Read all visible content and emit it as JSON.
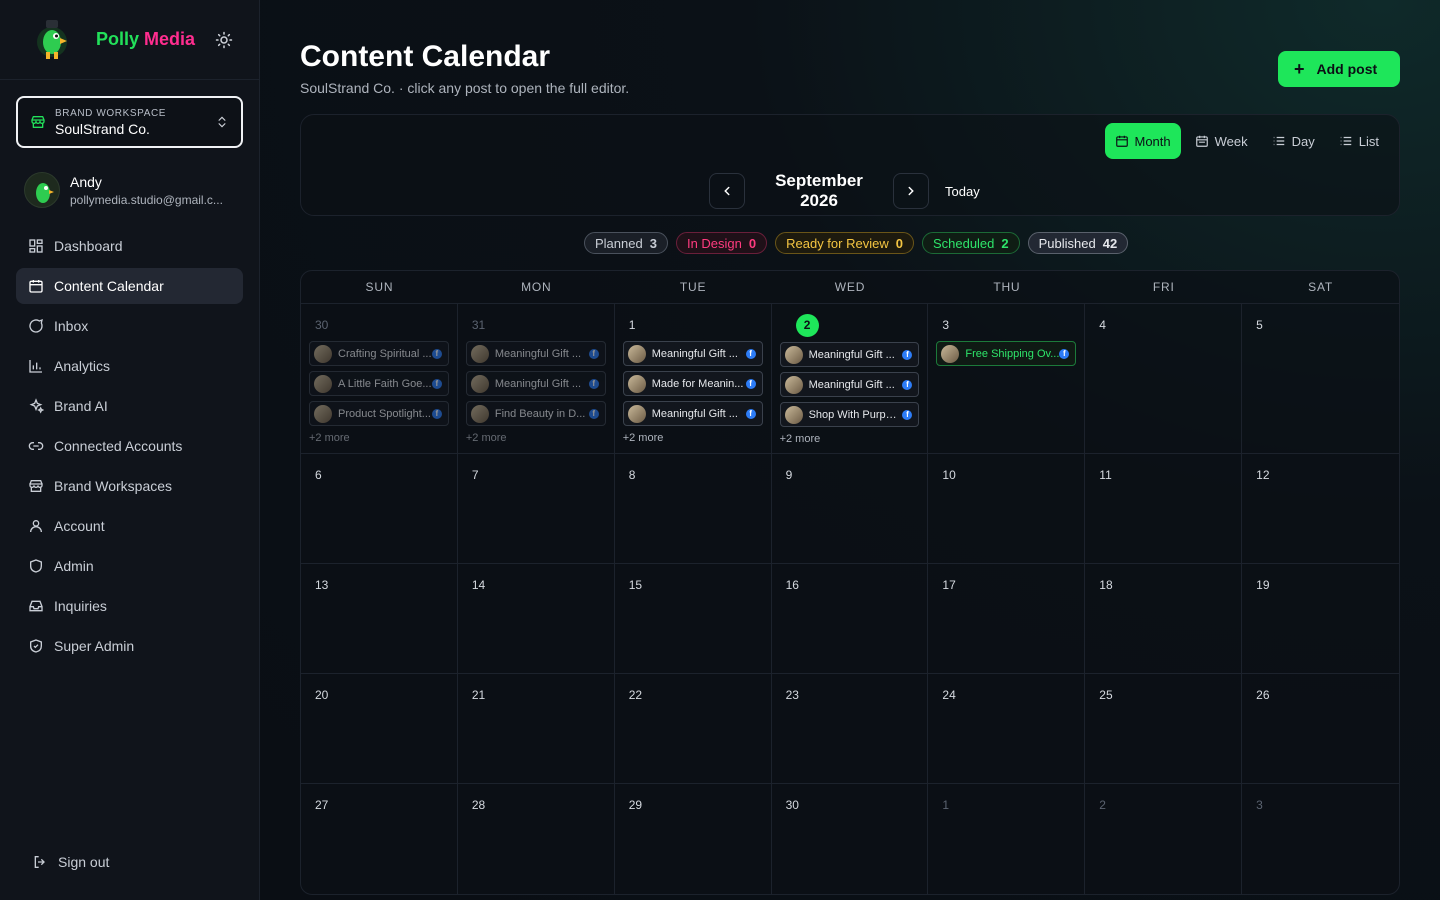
{
  "app": {
    "name_part1": "Polly",
    "name_part2": "Media"
  },
  "workspace": {
    "label": "BRAND WORKSPACE",
    "name": "SoulStrand Co."
  },
  "user": {
    "name": "Andy",
    "email": "pollymedia.studio@gmail.c..."
  },
  "nav": [
    {
      "label": "Dashboard",
      "icon": "dashboard-icon"
    },
    {
      "label": "Content Calendar",
      "icon": "calendar-icon",
      "active": true
    },
    {
      "label": "Inbox",
      "icon": "inbox-icon"
    },
    {
      "label": "Analytics",
      "icon": "analytics-icon"
    },
    {
      "label": "Brand AI",
      "icon": "sparkles-icon"
    },
    {
      "label": "Connected Accounts",
      "icon": "link-icon"
    },
    {
      "label": "Brand Workspaces",
      "icon": "store-icon"
    },
    {
      "label": "Account",
      "icon": "user-icon"
    },
    {
      "label": "Admin",
      "icon": "shield-icon"
    },
    {
      "label": "Inquiries",
      "icon": "inbox-tray-icon"
    },
    {
      "label": "Super Admin",
      "icon": "shield-check-icon"
    }
  ],
  "signout": "Sign out",
  "page": {
    "title": "Content Calendar",
    "subtitle": "SoulStrand Co. · click any post to open the full editor.",
    "add_post": "Add post"
  },
  "views": [
    {
      "label": "Month",
      "active": true
    },
    {
      "label": "Week"
    },
    {
      "label": "Day"
    },
    {
      "label": "List"
    }
  ],
  "month_label": "September 2026",
  "today_label": "Today",
  "statuses": [
    {
      "label": "Planned",
      "count": "3",
      "color": "#c9ced6",
      "border": "#4a515c",
      "bg": "#1a1f27"
    },
    {
      "label": "In Design",
      "count": "0",
      "color": "#ff3b7f",
      "border": "#6a1f3a",
      "bg": "#1f1018"
    },
    {
      "label": "Ready for Review",
      "count": "0",
      "color": "#f4c542",
      "border": "#6a5518",
      "bg": "#1d1a0e"
    },
    {
      "label": "Scheduled",
      "count": "2",
      "color": "#2ee46a",
      "border": "#1c6a36",
      "bg": "#0f1d14"
    },
    {
      "label": "Published",
      "count": "42",
      "color": "#e6e8ec",
      "border": "#5a616c",
      "bg": "#222833"
    }
  ],
  "weekdays": [
    "SUN",
    "MON",
    "TUE",
    "WED",
    "THU",
    "FRI",
    "SAT"
  ],
  "days": [
    {
      "num": "30",
      "out": true,
      "posts": [
        "Crafting Spiritual ...",
        "A Little Faith Goe...",
        "Product Spotlight..."
      ],
      "more": "+2 more"
    },
    {
      "num": "31",
      "out": true,
      "posts": [
        "Meaningful Gift ...",
        "Meaningful Gift ...",
        "Find Beauty in D..."
      ],
      "more": "+2 more"
    },
    {
      "num": "1",
      "posts": [
        "Meaningful Gift ...",
        "Made for Meanin...",
        "Meaningful Gift ..."
      ],
      "more": "+2 more"
    },
    {
      "num": "2",
      "today": true,
      "posts": [
        "Meaningful Gift ...",
        "Meaningful Gift ...",
        "Shop With Purpose"
      ],
      "more": "+2 more"
    },
    {
      "num": "3",
      "posts": [
        "Free Shipping Ov..."
      ],
      "scheduled": true
    },
    {
      "num": "4"
    },
    {
      "num": "5"
    },
    {
      "num": "6"
    },
    {
      "num": "7"
    },
    {
      "num": "8"
    },
    {
      "num": "9"
    },
    {
      "num": "10"
    },
    {
      "num": "11"
    },
    {
      "num": "12"
    },
    {
      "num": "13"
    },
    {
      "num": "14"
    },
    {
      "num": "15"
    },
    {
      "num": "16"
    },
    {
      "num": "17"
    },
    {
      "num": "18"
    },
    {
      "num": "19"
    },
    {
      "num": "20"
    },
    {
      "num": "21"
    },
    {
      "num": "22"
    },
    {
      "num": "23"
    },
    {
      "num": "24"
    },
    {
      "num": "25"
    },
    {
      "num": "26"
    },
    {
      "num": "27"
    },
    {
      "num": "28"
    },
    {
      "num": "29"
    },
    {
      "num": "30"
    },
    {
      "num": "1",
      "out": true
    },
    {
      "num": "2",
      "out": true
    },
    {
      "num": "3",
      "out": true
    }
  ],
  "facebook_glyph": "f"
}
